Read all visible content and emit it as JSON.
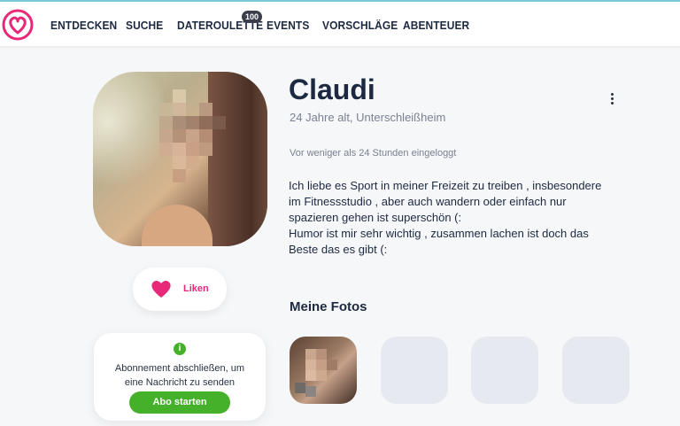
{
  "nav": {
    "items": [
      "ENTDECKEN",
      "SUCHE",
      "DATEROULETTE",
      "EVENTS",
      "VORSCHLÄGE",
      "ABENTEUER"
    ],
    "badge": "100",
    "logo_icon": "heart-logo-icon"
  },
  "colors": {
    "accent_pink": "#e8297a",
    "green": "#45b12a",
    "navy": "#1d2940"
  },
  "profile": {
    "name": "Claudi",
    "meta": "24 Jahre alt, Unterschleißheim",
    "online": "Vor weniger als 24 Stunden eingeloggt",
    "bio_lines": [
      "Ich liebe es Sport in meiner Freizeit zu treiben , insbesondere",
      "im Fitnessstudio , aber auch wandern oder einfach nur",
      "spazieren gehen ist superschön (:",
      "Humor ist mir sehr wichtig , zusammen lachen ist doch das",
      "Beste das es gibt (:"
    ]
  },
  "like": {
    "label": "Liken",
    "icon": "heart-icon"
  },
  "subscription": {
    "info_icon": "i",
    "message_lines": [
      "Abonnement abschließen, um",
      "eine Nachricht zu senden"
    ],
    "button_label": "Abo starten"
  },
  "photos": {
    "title": "Meine Fotos"
  }
}
